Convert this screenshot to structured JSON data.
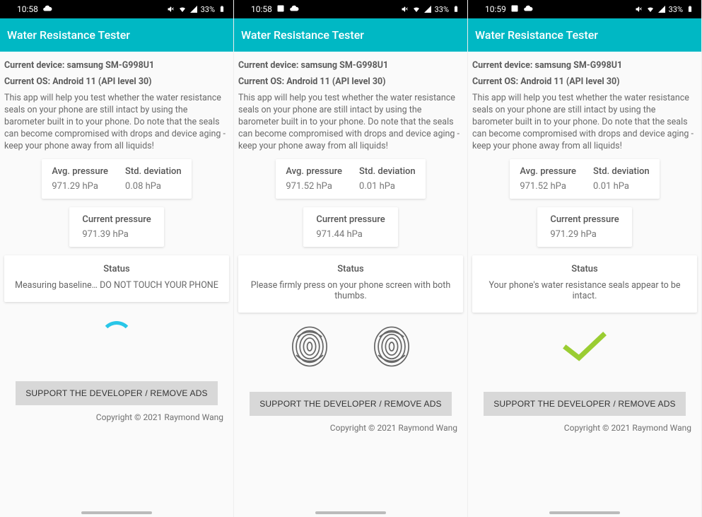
{
  "screens": [
    {
      "time": "10:58",
      "status_icons_left": [
        "cloud"
      ],
      "battery_text": "33%",
      "app_title": "Water Resistance Tester",
      "device_line": "Current device: samsung SM-G998U1",
      "os_line": "Current OS: Android 11 (API level 30)",
      "description": "This app will help you test whether the water resistance seals on your phone are still intact by using the barometer built in to your phone. Do note that the seals can become compromised with drops and device aging - keep your phone away from all liquids!",
      "avg_label": "Avg. pressure",
      "avg_value": "971.29 hPa",
      "std_label": "Std. deviation",
      "std_value": "0.08 hPa",
      "cur_label": "Current pressure",
      "cur_value": "971.39 hPa",
      "status_label": "Status",
      "status_message": "Measuring baseline… DO NOT TOUCH YOUR PHONE",
      "visual": "spinner",
      "button": "SUPPORT THE DEVELOPER / REMOVE ADS",
      "copyright": "Copyright © 2021 Raymond Wang"
    },
    {
      "time": "10:58",
      "status_icons_left": [
        "image",
        "cloud"
      ],
      "battery_text": "33%",
      "app_title": "Water Resistance Tester",
      "device_line": "Current device: samsung SM-G998U1",
      "os_line": "Current OS: Android 11 (API level 30)",
      "description": "This app will help you test whether the water resistance seals on your phone are still intact by using the barometer built in to your phone. Do note that the seals can become compromised with drops and device aging - keep your phone away from all liquids!",
      "avg_label": "Avg. pressure",
      "avg_value": "971.52 hPa",
      "std_label": "Std. deviation",
      "std_value": "0.01 hPa",
      "cur_label": "Current pressure",
      "cur_value": "971.44 hPa",
      "status_label": "Status",
      "status_message": "Please firmly press on your phone screen with both thumbs.",
      "visual": "fingerprints",
      "button": "SUPPORT THE DEVELOPER / REMOVE ADS",
      "copyright": "Copyright © 2021 Raymond Wang"
    },
    {
      "time": "10:59",
      "status_icons_left": [
        "image",
        "cloud"
      ],
      "battery_text": "33%",
      "app_title": "Water Resistance Tester",
      "device_line": "Current device: samsung SM-G998U1",
      "os_line": "Current OS: Android 11 (API level 30)",
      "description": "This app will help you test whether the water resistance seals on your phone are still intact by using the barometer built in to your phone. Do note that the seals can become compromised with drops and device aging - keep your phone away from all liquids!",
      "avg_label": "Avg. pressure",
      "avg_value": "971.52 hPa",
      "std_label": "Std. deviation",
      "std_value": "0.01 hPa",
      "cur_label": "Current pressure",
      "cur_value": "971.29 hPa",
      "status_label": "Status",
      "status_message": "Your phone's water resistance seals appear to be intact.",
      "visual": "checkmark",
      "button": "SUPPORT THE DEVELOPER / REMOVE ADS",
      "copyright": "Copyright © 2021 Raymond Wang"
    }
  ]
}
